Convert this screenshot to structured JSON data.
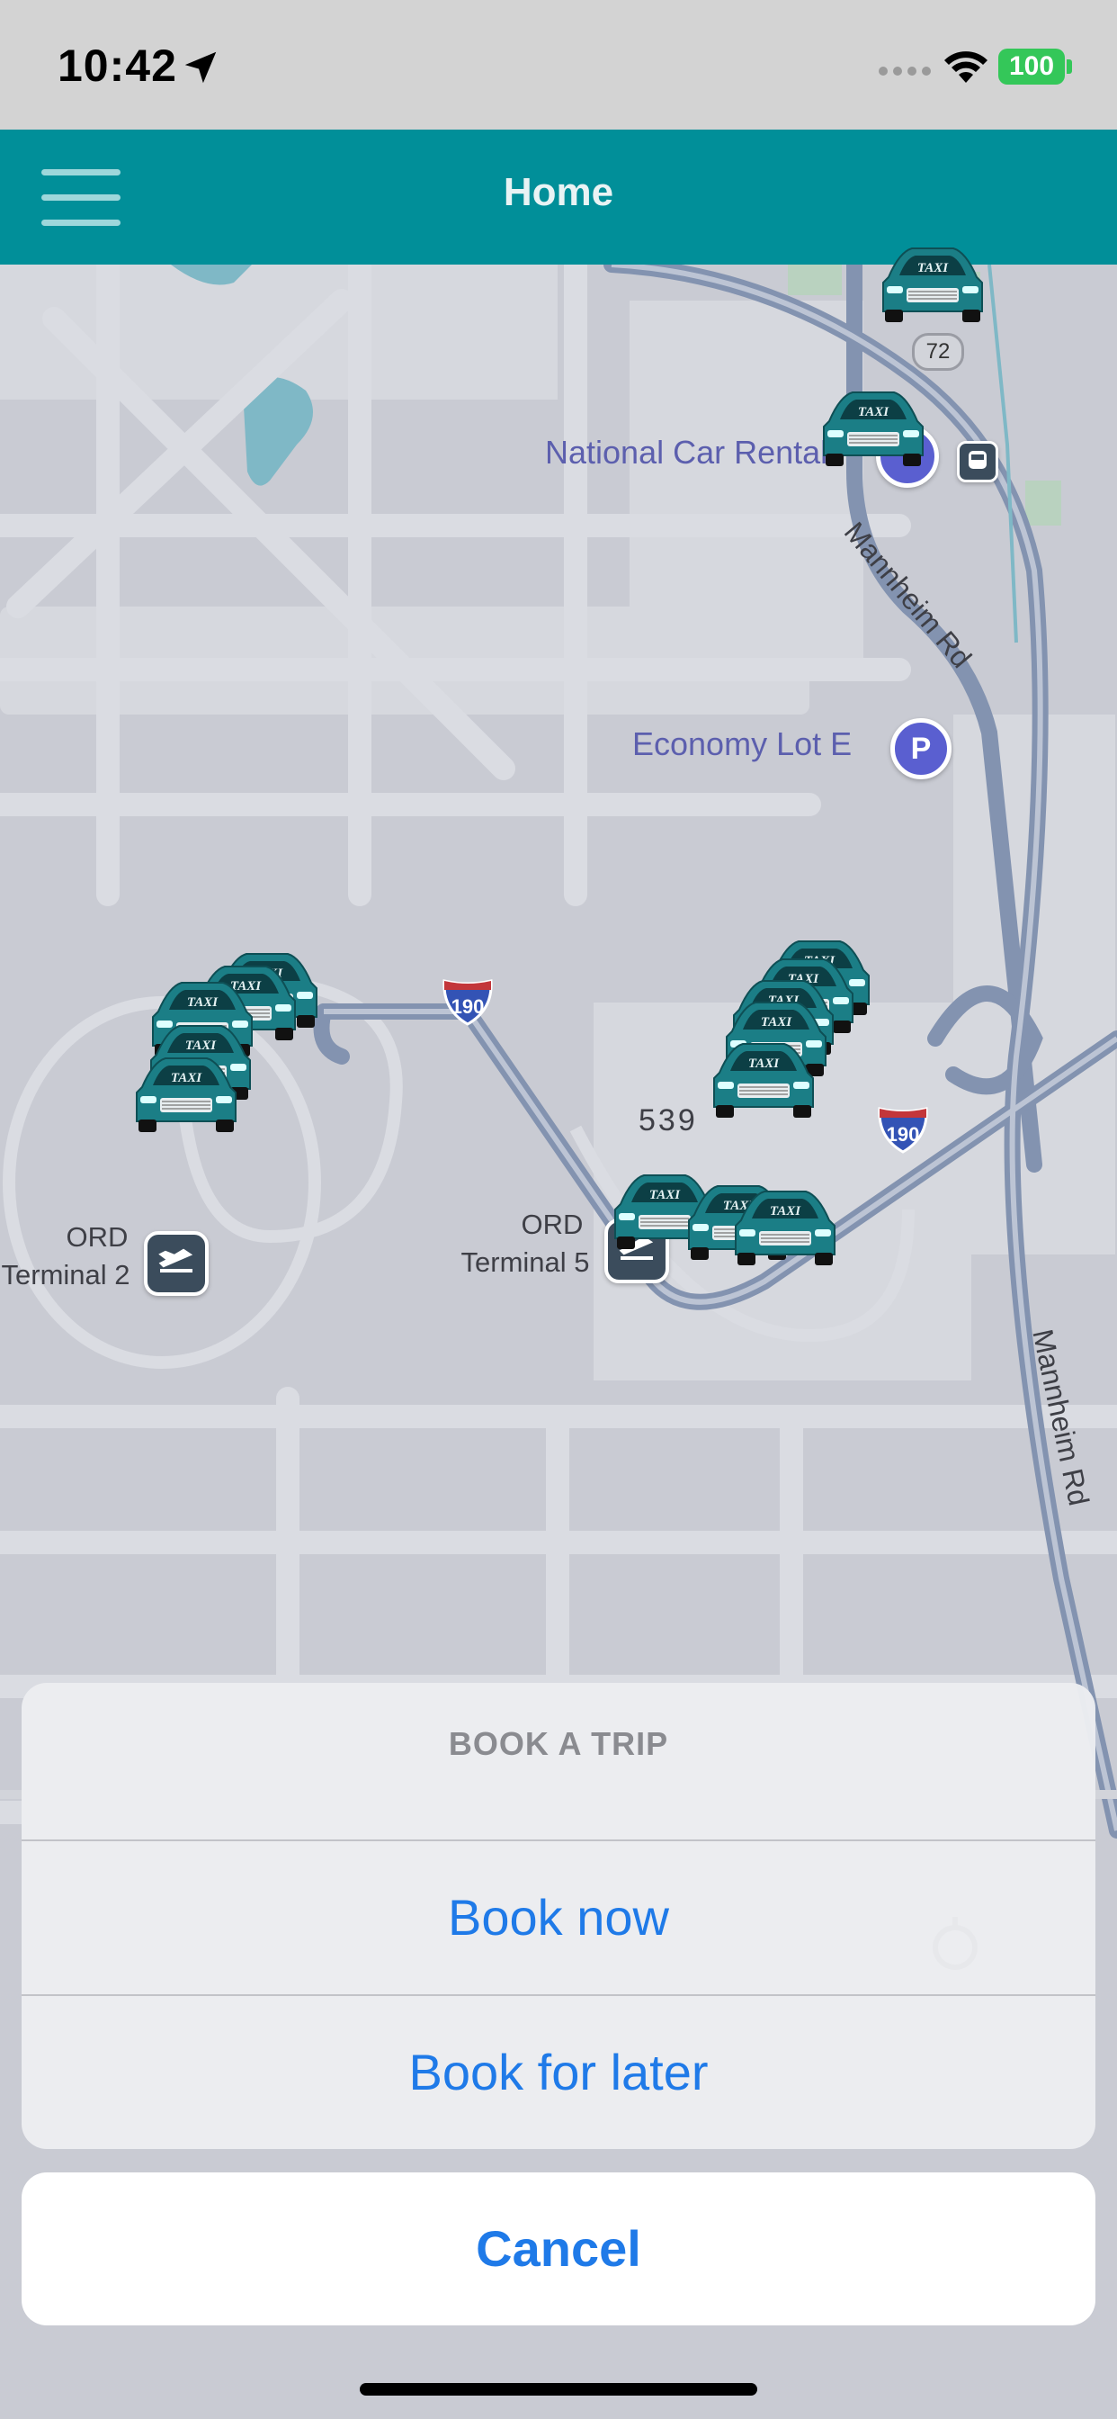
{
  "status_bar": {
    "time": "10:42",
    "battery": "100",
    "icons": [
      "location-arrow-icon",
      "cellular-signal-icon",
      "wifi-icon",
      "battery-icon"
    ]
  },
  "nav": {
    "title": "Home",
    "menu_icon": "hamburger-menu-icon"
  },
  "map": {
    "labels": {
      "national_car_rental": "National Car Rental",
      "economy_lot": "Economy Lot E",
      "parking_badge": "P",
      "mannheim_top": "Mannheim Rd",
      "mannheim_bottom": "Mannheim Rd",
      "terminal2_line1": "ORD",
      "terminal2_line2": "Terminal 2",
      "terminal5_line1": "ORD",
      "terminal5_line2": "Terminal 5",
      "route_539": "539",
      "route_72": "72",
      "interstate_a": "190",
      "interstate_b": "190"
    },
    "taxi_label": "TAXI"
  },
  "action_sheet": {
    "title": "BOOK A TRIP",
    "book_now": "Book now",
    "book_later": "Book for later",
    "cancel": "Cancel"
  },
  "colors": {
    "nav_bar": "#018f99",
    "taxi": "#1b7e86",
    "action_blue": "#1f7ae8",
    "battery_green": "#34c759"
  }
}
